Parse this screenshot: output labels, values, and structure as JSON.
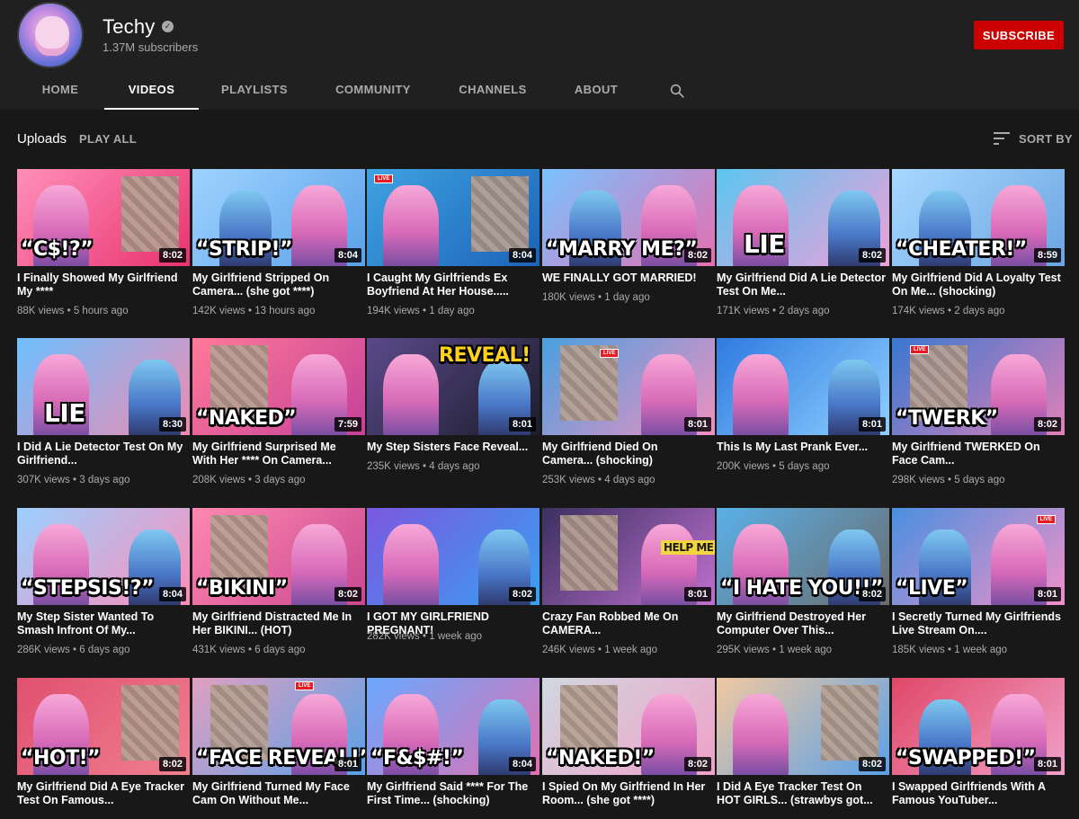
{
  "channel": {
    "name": "Techy",
    "subscribers": "1.37M subscribers",
    "subscribe_label": "SUBSCRIBE",
    "accent_color": "#cc0000",
    "verified_icon": "check-circle-icon"
  },
  "tabs": [
    {
      "label": "HOME",
      "active": false
    },
    {
      "label": "VIDEOS",
      "active": true
    },
    {
      "label": "PLAYLISTS",
      "active": false
    },
    {
      "label": "COMMUNITY",
      "active": false
    },
    {
      "label": "CHANNELS",
      "active": false
    },
    {
      "label": "ABOUT",
      "active": false
    }
  ],
  "uploads": {
    "label": "Uploads",
    "play_all": "PLAY ALL",
    "sort_by": "SORT BY"
  },
  "videos": [
    {
      "title": "I Finally Showed My Girlfriend My ****",
      "views": "88K views",
      "age": "5 hours ago",
      "duration": "8:02",
      "caption": "“C$!?”"
    },
    {
      "title": "My Girlfriend Stripped On Camera... (she got ****)",
      "views": "142K views",
      "age": "13 hours ago",
      "duration": "8:04",
      "caption": "“STRIP!”"
    },
    {
      "title": "I Caught My Girlfriends Ex Boyfriend At Her House.....",
      "views": "194K views",
      "age": "1 day ago",
      "duration": "8:04",
      "caption": ""
    },
    {
      "title": "WE FINALLY GOT MARRIED!",
      "views": "180K views",
      "age": "1 day ago",
      "duration": "8:02",
      "caption": "“MARRY ME?”"
    },
    {
      "title": "My Girlfriend Did A Lie Detector Test On Me...",
      "views": "171K views",
      "age": "2 days ago",
      "duration": "8:02",
      "caption": "LIE"
    },
    {
      "title": "My Girlfriend Did A Loyalty Test On Me... (shocking)",
      "views": "174K views",
      "age": "2 days ago",
      "duration": "8:59",
      "caption": "“CHEATER!”"
    },
    {
      "title": "I Did A Lie Detector Test On My Girlfriend...",
      "views": "307K views",
      "age": "3 days ago",
      "duration": "8:30",
      "caption": "LIE"
    },
    {
      "title": "My Girlfriend Surprised Me With Her **** On Camera...",
      "views": "208K views",
      "age": "3 days ago",
      "duration": "7:59",
      "caption": "“NAKED”"
    },
    {
      "title": "My Step Sisters Face Reveal...",
      "views": "235K views",
      "age": "4 days ago",
      "duration": "8:01",
      "caption": "REVEAL!"
    },
    {
      "title": "My Girlfriend Died On Camera... (shocking)",
      "views": "253K views",
      "age": "4 days ago",
      "duration": "8:01",
      "caption": ""
    },
    {
      "title": "This Is My Last Prank Ever...",
      "views": "200K views",
      "age": "5 days ago",
      "duration": "8:01",
      "caption": ""
    },
    {
      "title": "My Girlfriend TWERKED On Face Cam...",
      "views": "298K views",
      "age": "5 days ago",
      "duration": "8:02",
      "caption": "“TWERK”"
    },
    {
      "title": "My Step Sister Wanted To Smash Infront Of My...",
      "views": "286K views",
      "age": "6 days ago",
      "duration": "8:04",
      "caption": "“STEPSIS!?”"
    },
    {
      "title": "My Girlfriend Distracted Me In Her BIKINI... (HOT)",
      "views": "431K views",
      "age": "6 days ago",
      "duration": "8:02",
      "caption": "“BIKINI”"
    },
    {
      "title": "I GOT MY GIRLFRIEND PREGNANT!",
      "views": "282K views",
      "age": "1 week ago",
      "duration": "8:02",
      "caption": ""
    },
    {
      "title": "Crazy Fan Robbed Me On CAMERA...",
      "views": "246K views",
      "age": "1 week ago",
      "duration": "8:01",
      "caption": "HELP ME"
    },
    {
      "title": "My Girlfriend Destroyed Her Computer Over This...",
      "views": "295K views",
      "age": "1 week ago",
      "duration": "8:02",
      "caption": "“I HATE YOU!!”"
    },
    {
      "title": "I Secretly Turned My Girlfriends Live Stream On....",
      "views": "185K views",
      "age": "1 week ago",
      "duration": "8:01",
      "caption": "“LIVE”"
    },
    {
      "title": "My Girlfriend Did A Eye Tracker Test On Famous...",
      "views": "",
      "age": "",
      "duration": "8:02",
      "caption": "“HOT!”"
    },
    {
      "title": "My Girlfriend Turned My Face Cam On Without Me...",
      "views": "",
      "age": "",
      "duration": "8:01",
      "caption": "“FACE REVEAL!”"
    },
    {
      "title": "My Girlfriend Said **** For The First Time... (shocking)",
      "views": "",
      "age": "",
      "duration": "8:04",
      "caption": "“F&$#!”"
    },
    {
      "title": "I Spied On My Girlfriend In Her Room... (she got ****)",
      "views": "",
      "age": "",
      "duration": "8:02",
      "caption": "“NAKED!”"
    },
    {
      "title": "I Did A Eye Tracker Test On HOT GIRLS... (strawbys got...",
      "views": "",
      "age": "",
      "duration": "8:02",
      "caption": ""
    },
    {
      "title": "I Swapped Girlfriends With A Famous YouTuber...",
      "views": "",
      "age": "",
      "duration": "8:01",
      "caption": "“SWAPPED!”"
    }
  ],
  "thumb_live_label": "LIVE"
}
